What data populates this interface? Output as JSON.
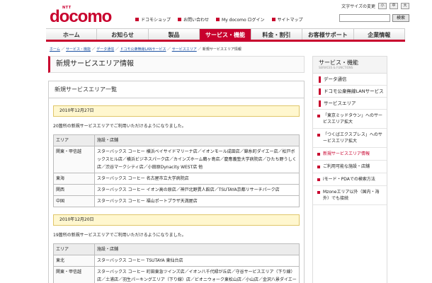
{
  "header": {
    "logo_ntt": "NTT",
    "logo_text": "docomo",
    "font_size_label": "文字サイズの変更",
    "font_sizes": [
      "小",
      "中",
      "大"
    ],
    "search_placeholder": "",
    "search_button": "検索",
    "top_links": [
      "ドコモショップ",
      "お問い合わせ",
      "My docomo ログイン",
      "サイトマップ"
    ]
  },
  "nav": [
    "ホーム",
    "お知らせ",
    "製品",
    "サービス・機能",
    "料金・割引",
    "お客様サポート",
    "企業情報"
  ],
  "nav_active": 3,
  "breadcrumb": {
    "links": [
      "ホーム",
      "サービス・機能",
      "データ通信",
      "ドコモ公衆無線LANサービス",
      "サービスエリア"
    ],
    "current": "新規サービスエリア情報"
  },
  "page_title": "新規サービスエリア情報",
  "main": {
    "heading": "新規サービスエリア一覧",
    "sections": [
      {
        "date": "2010年12月27日",
        "intro": "20箇所の新規サービスエリアでご利用いただけるようになりました。",
        "headers": [
          "エリア",
          "施設・店舗"
        ],
        "rows": [
          {
            "area": "関東・甲信越",
            "shops": "スターバックス コーヒー 横浜ベイサイドマリーナ店／イオンモール成田店／錦糸町ダイエー店／松戸ボックスヒル店／横浜ビジネスパーク店／カインズホーム鶴ヶ島店／慶應義塾大学病院店／ひたち野うしく店／渋谷マークシティ店／小田原Dynacity WEST店 他"
          },
          {
            "area": "東海",
            "shops": "スターバックス コーヒー 名古屋市立大学病院店"
          },
          {
            "area": "関西",
            "shops": "スターバックス コーヒー イオン高の原店／神戸北野異人館店／TSUTAYA京都リサーチパーク店"
          },
          {
            "area": "中国",
            "shops": "スターバックス コーヒー 福山ポートプラザ天満屋店"
          }
        ]
      },
      {
        "date": "2010年12月20日",
        "intro": "19箇所の新規サービスエリアでご利用いただけるようになりました。",
        "headers": [
          "エリア",
          "施設・店舗"
        ],
        "rows": [
          {
            "area": "東北",
            "shops": "スターバックス コーヒー TSUTAYA 東仙台店"
          },
          {
            "area": "関東・甲信越",
            "shops": "スターバックス コーヒー 町田東急ツインズ店／イオン八千代緑が丘店／守谷サービスエリア（下り線）店／土浦店／羽生パーキングエリア（下り線）店／ビオニウォーク東松山店／小山店／金沢八景ダイエー店"
          }
        ]
      }
    ]
  },
  "sidebar": {
    "title": "サービス・機能",
    "subtitle": "SERVICES & FUNCTIONS",
    "link1": "データ通信",
    "link2": "ドコモ公衆無線LANサービス",
    "link3": "サービスエリア",
    "sub_items": [
      "「東京ミッドタウン」へのサービスエリア拡大",
      "「つくばエクスプレス」へのサービスエリア拡大",
      "新規サービスエリア情報",
      "ご利用可能な施設・店舗",
      "iモード・PDAでの検索方法",
      "Mzoneエリア以外（国内・海外）でも接続"
    ],
    "current_index": 2
  }
}
